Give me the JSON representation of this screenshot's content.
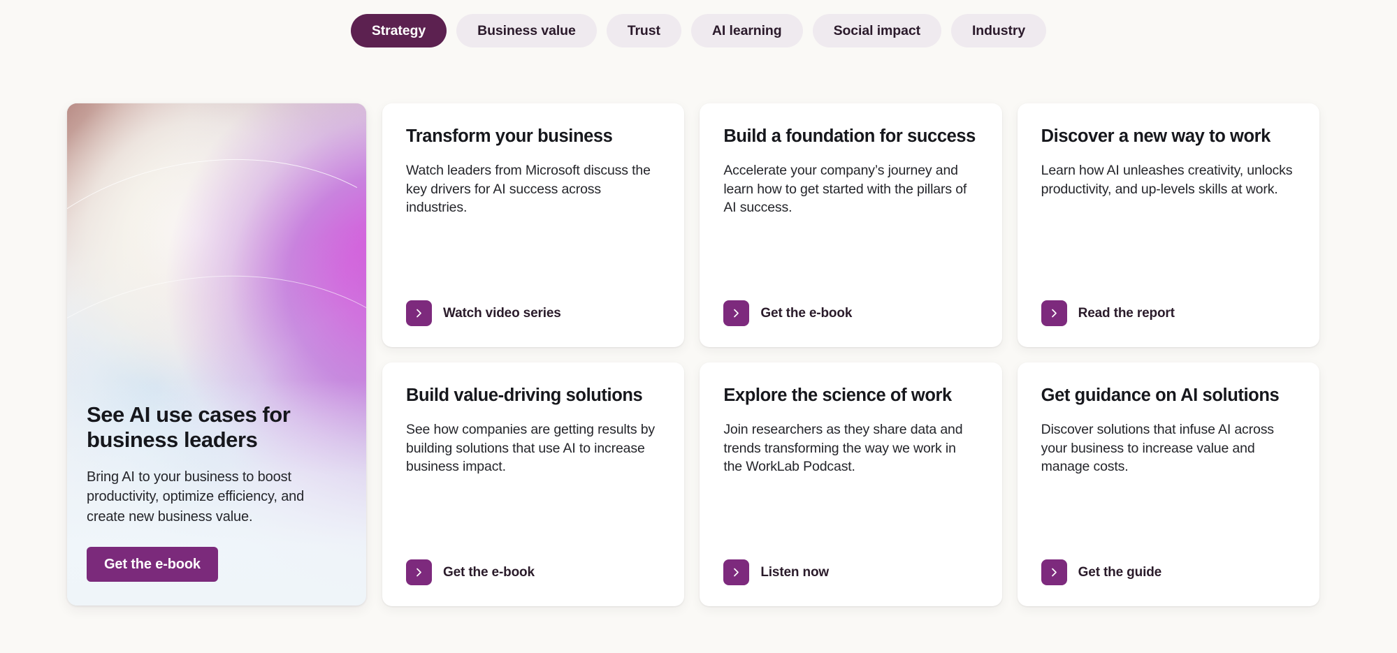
{
  "theme": {
    "page_background": "#faf9f6",
    "accent_purple": "#7d2a7d",
    "active_tab_purple": "#5c2150",
    "inactive_tab_background": "#efeaef",
    "card_background": "#ffffff",
    "heading_color": "#16171c"
  },
  "tabs": [
    {
      "label": "Strategy",
      "active": true
    },
    {
      "label": "Business value",
      "active": false
    },
    {
      "label": "Trust",
      "active": false
    },
    {
      "label": "AI learning",
      "active": false
    },
    {
      "label": "Social impact",
      "active": false
    },
    {
      "label": "Industry",
      "active": false
    }
  ],
  "hero": {
    "image_alt": "abstract-iridescent-swirl",
    "title": "See AI use cases for business leaders",
    "description": "Bring AI to your business to boost productivity, optimize efficiency, and create new business value.",
    "cta_label": "Get the e-book"
  },
  "cards": [
    {
      "title": "Transform your business",
      "description": "Watch leaders from Microsoft discuss the key drivers for AI success across industries.",
      "link_label": "Watch video series",
      "link_icon": "chevron-right-icon"
    },
    {
      "title": "Build a foundation for success",
      "description": "Accelerate your company’s journey and learn how to get started with the pillars of AI success.",
      "link_label": "Get the e-book",
      "link_icon": "chevron-right-icon"
    },
    {
      "title": "Discover a new way to work",
      "description": "Learn how AI unleashes creativity, unlocks productivity, and up-levels skills at work.",
      "link_label": "Read the report",
      "link_icon": "chevron-right-icon"
    },
    {
      "title": "Build value-driving solutions",
      "description": "See how companies are getting results by building solutions that use AI to increase business impact.",
      "link_label": "Get the e-book",
      "link_icon": "chevron-right-icon"
    },
    {
      "title": "Explore the science of work",
      "description": "Join researchers as they share data and trends transforming the way we work in the WorkLab Podcast.",
      "link_label": "Listen now",
      "link_icon": "chevron-right-icon"
    },
    {
      "title": "Get guidance on AI solutions",
      "description": "Discover solutions that infuse AI across your business to increase value and manage costs.",
      "link_label": "Get the guide",
      "link_icon": "chevron-right-icon"
    }
  ]
}
